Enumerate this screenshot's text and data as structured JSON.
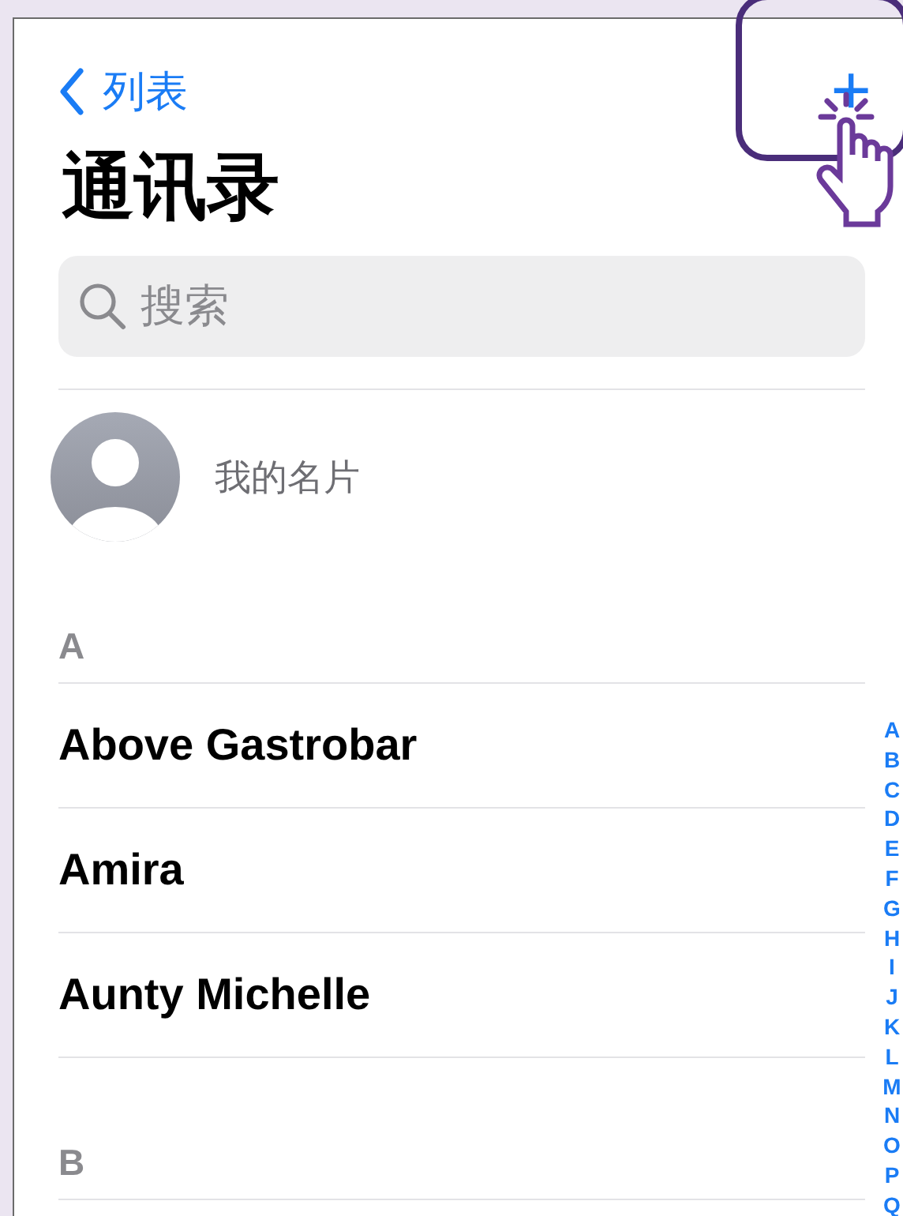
{
  "nav": {
    "back_label": "列表",
    "add_symbol": "+"
  },
  "title": "通讯录",
  "search": {
    "placeholder": "搜索"
  },
  "my_card": {
    "label": "我的名片"
  },
  "sections": [
    {
      "letter": "A",
      "contacts": [
        "Above Gastrobar",
        "Amira",
        "Aunty Michelle"
      ]
    },
    {
      "letter": "B"
    }
  ],
  "index": [
    "A",
    "B",
    "C",
    "D",
    "E",
    "F",
    "G",
    "H",
    "I",
    "J",
    "K",
    "L",
    "M",
    "N",
    "O",
    "P",
    "Q"
  ]
}
